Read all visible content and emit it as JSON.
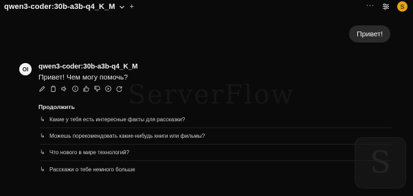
{
  "header": {
    "model_name": "qwen3-coder:30b-a3b-q4_K_M",
    "new_chat_symbol": "+",
    "menu_symbol": "···",
    "avatar_initial": "S",
    "avatar_color": "#e8a21a"
  },
  "conversation": {
    "user_message": "Привет!",
    "assistant": {
      "logo_text": "OI",
      "name": "qwen3-coder:30b-a3b-q4_K_M",
      "message": "Привет! Чем могу помочь?",
      "actions": [
        "edit-icon",
        "copy-icon",
        "speaker-icon",
        "info-icon",
        "thumbs-up-icon",
        "thumbs-down-icon",
        "continue-icon",
        "regenerate-icon"
      ]
    }
  },
  "followups": {
    "title": "Продолжить",
    "arrow": "↳",
    "items": [
      "Какие у тебя есть интересные факты для рассказки?",
      "Можешь порекомендовать какие-нибудь книги или фильмы?",
      "Что нового в мире технологий?",
      "Расскажи о тебе немного больше"
    ]
  },
  "watermark": {
    "text": "ServerFlow",
    "badge_letter": "S"
  }
}
